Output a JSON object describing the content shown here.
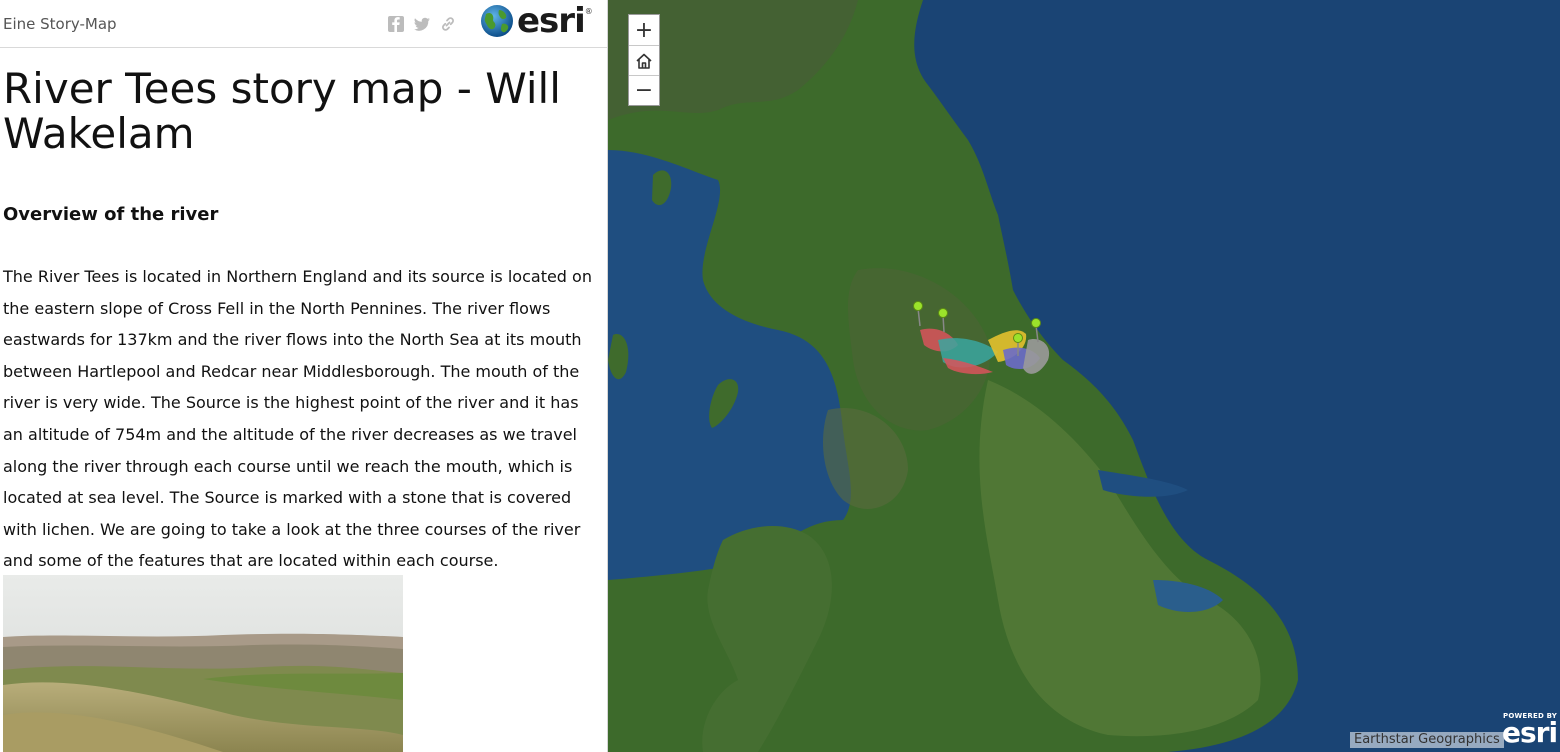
{
  "header": {
    "subtitle": "Eine Story-Map",
    "share_icons": [
      "facebook-icon",
      "twitter-icon",
      "link-icon"
    ],
    "logo_text": "esri",
    "logo_reg": "®"
  },
  "story": {
    "title": "River Tees story map - Will Wakelam",
    "section_heading": "Overview of the river",
    "paragraph": "The River Tees is located in Northern England and its source is located on the eastern slope of Cross Fell in the North Pennines. The river flows eastwards for 137km and the river flows into the North Sea at its mouth between Hartlepool and Redcar near Middlesborough. The mouth of the river is very wide. The Source is the highest point of the river and it has an altitude of 754m and the altitude of the river decreases as we travel along the river through each course until we reach the mouth, which is located at sea level. The Source is marked with a stone that is covered with lichen. We are going to take a look at the three courses of the river and some of the features that are located within each course."
  },
  "map": {
    "zoom_in": "+",
    "home": "home-icon",
    "zoom_out": "−",
    "attribution": "Earthstar Geographics",
    "powered_by": "POWERED BY",
    "powered_logo": "esri",
    "colors": {
      "sea": "#1a4474",
      "land": "#3f6b2c",
      "marker": "#9be22b",
      "polygon_red": "#d9545c",
      "polygon_teal": "#3aa6a0",
      "polygon_yellow": "#e3c12e",
      "polygon_blue": "#6b6bc9",
      "polygon_grey": "#9a9a9a"
    }
  }
}
